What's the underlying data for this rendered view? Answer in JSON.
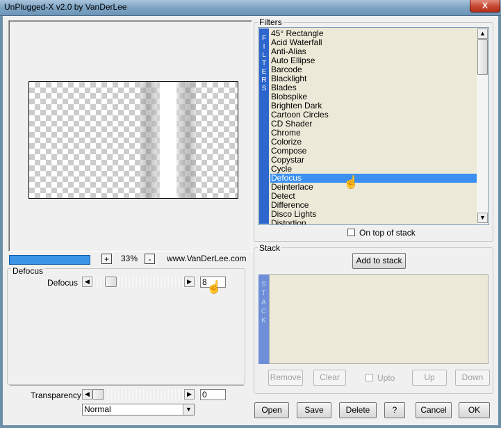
{
  "window": {
    "title": "UnPlugged-X v2.0 by VanDerLee",
    "close_label": "X"
  },
  "preview": {
    "zoom_minus": "-",
    "zoom_plus": "+",
    "zoom_value": "33%",
    "website": "www.VanDerLee.com",
    "progress": 1.0
  },
  "filter_params": {
    "group_label": "Defocus",
    "param_label": "Defocus",
    "param_value": "8",
    "transparency_label": "Transparency",
    "transparency_value": "0",
    "blend_mode": "Normal"
  },
  "filters": {
    "group_label": "Filters",
    "side_label": [
      "F",
      "I",
      "L",
      "T",
      "E",
      "R",
      "S"
    ],
    "items": [
      "45° Rectangle",
      "Acid Waterfall",
      "Anti-Alias",
      "Auto Ellipse",
      "Barcode",
      "Blacklight",
      "Blades",
      "Blobspike",
      "Brighten Dark",
      "Cartoon Circles",
      "CD Shader",
      "Chrome",
      "Colorize",
      "Compose",
      "Copystar",
      "Cycle",
      "Defocus",
      "Deinterlace",
      "Detect",
      "Difference",
      "Disco Lights",
      "Distortion"
    ],
    "selected": "Defocus",
    "on_top_label": "On top of stack",
    "on_top_checked": false
  },
  "stack": {
    "group_label": "Stack",
    "add_label": "Add to stack",
    "side_label": [
      "S",
      "T",
      "A",
      "C",
      "K"
    ],
    "remove_label": "Remove",
    "clear_label": "Clear",
    "upto_label": "Upto",
    "up_label": "Up",
    "down_label": "Down"
  },
  "footer": {
    "open": "Open",
    "save": "Save",
    "delete": "Delete",
    "help": "?",
    "cancel": "Cancel",
    "ok": "OK"
  },
  "icons": {
    "scroll_up": "scroll-up-arrow-icon",
    "scroll_down": "scroll-down-arrow-icon",
    "left": "left-arrow-icon",
    "right": "right-arrow-icon",
    "cursor": "hand-cursor-icon"
  }
}
